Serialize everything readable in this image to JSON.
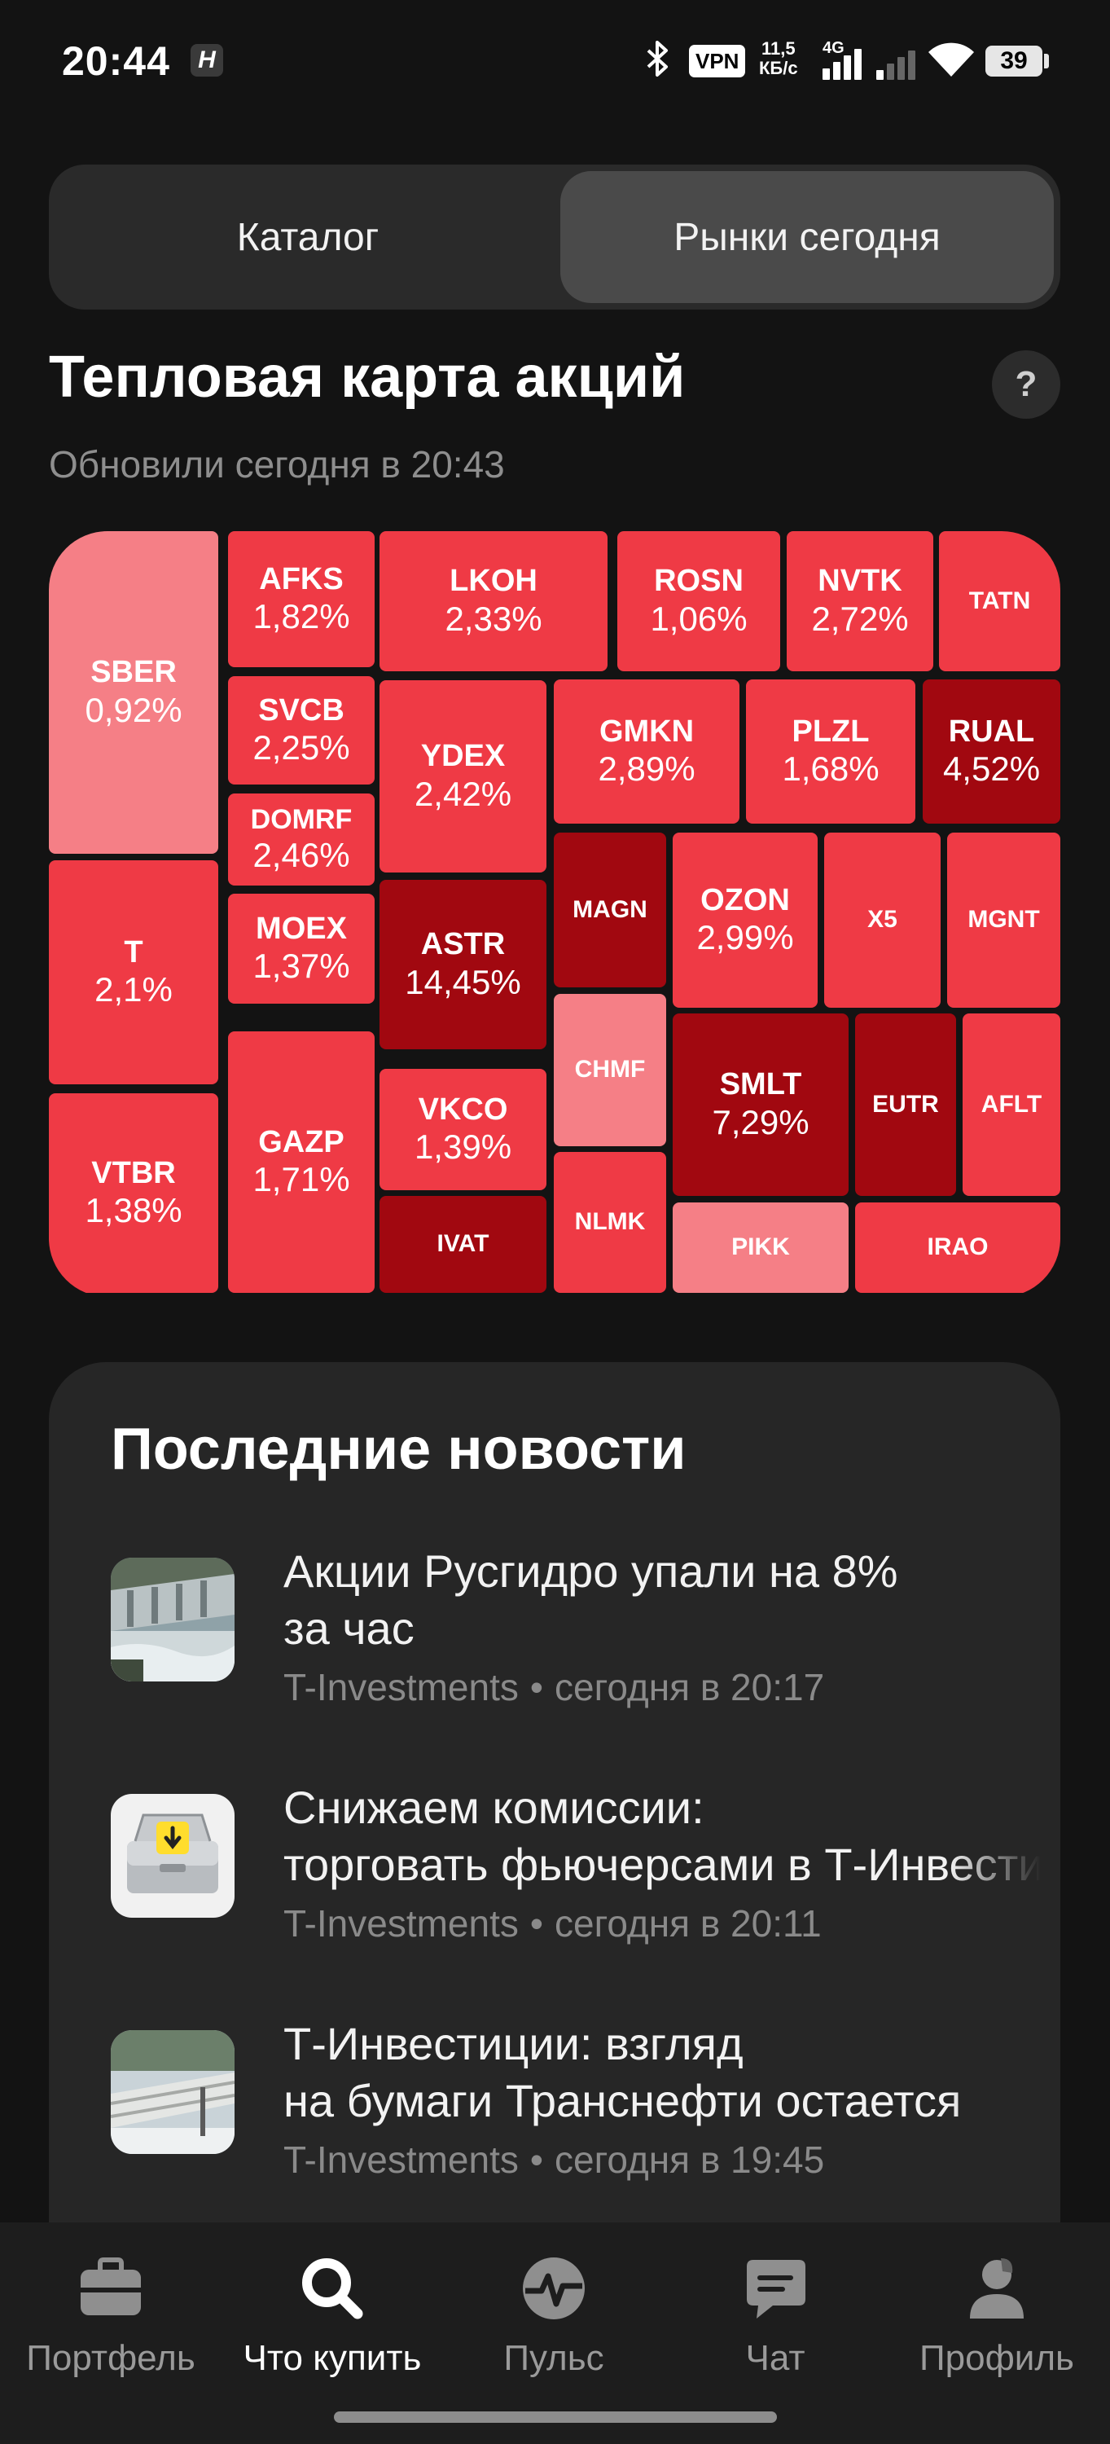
{
  "status_bar": {
    "time": "20:44",
    "app_badge": "H",
    "vpn": "VPN",
    "net_speed_value": "11,5",
    "net_speed_unit": "КБ/с",
    "network": "4G",
    "battery": "39"
  },
  "segment": {
    "tabs": [
      {
        "label": "Каталог",
        "active": false
      },
      {
        "label": "Рынки сегодня",
        "active": true
      }
    ]
  },
  "heatmap": {
    "title": "Тепловая карта акций",
    "help": "?",
    "updated": "Обновили сегодня в 20:43",
    "colors": {
      "light": "#f57f86",
      "mid": "#ef3a45",
      "dark": "#a10810"
    },
    "tiles": [
      {
        "ticker": "SBER",
        "change": "0,92%",
        "tone": "light"
      },
      {
        "ticker": "T",
        "change": "2,1%",
        "tone": "mid"
      },
      {
        "ticker": "VTBR",
        "change": "1,38%",
        "tone": "mid"
      },
      {
        "ticker": "AFKS",
        "change": "1,82%",
        "tone": "mid"
      },
      {
        "ticker": "SVCB",
        "change": "2,25%",
        "tone": "mid"
      },
      {
        "ticker": "DOMRF",
        "change": "2,46%",
        "tone": "mid"
      },
      {
        "ticker": "MOEX",
        "change": "1,37%",
        "tone": "mid"
      },
      {
        "ticker": "GAZP",
        "change": "1,71%",
        "tone": "mid"
      },
      {
        "ticker": "LKOH",
        "change": "2,33%",
        "tone": "mid"
      },
      {
        "ticker": "YDEX",
        "change": "2,42%",
        "tone": "mid"
      },
      {
        "ticker": "ASTR",
        "change": "14,45%",
        "tone": "dark"
      },
      {
        "ticker": "VKCO",
        "change": "1,39%",
        "tone": "mid"
      },
      {
        "ticker": "IVAT",
        "change": "",
        "tone": "dark"
      },
      {
        "ticker": "ROSN",
        "change": "1,06%",
        "tone": "mid"
      },
      {
        "ticker": "NVTK",
        "change": "2,72%",
        "tone": "mid"
      },
      {
        "ticker": "TATN",
        "change": "",
        "tone": "mid"
      },
      {
        "ticker": "GMKN",
        "change": "2,89%",
        "tone": "mid"
      },
      {
        "ticker": "PLZL",
        "change": "1,68%",
        "tone": "mid"
      },
      {
        "ticker": "RUAL",
        "change": "4,52%",
        "tone": "dark"
      },
      {
        "ticker": "MAGN",
        "change": "",
        "tone": "dark"
      },
      {
        "ticker": "OZON",
        "change": "2,99%",
        "tone": "mid"
      },
      {
        "ticker": "X5",
        "change": "",
        "tone": "mid"
      },
      {
        "ticker": "MGNT",
        "change": "",
        "tone": "mid"
      },
      {
        "ticker": "CHMF",
        "change": "",
        "tone": "light"
      },
      {
        "ticker": "SMLT",
        "change": "7,29%",
        "tone": "dark"
      },
      {
        "ticker": "EUTR",
        "change": "",
        "tone": "dark"
      },
      {
        "ticker": "AFLT",
        "change": "",
        "tone": "mid"
      },
      {
        "ticker": "NLMK",
        "change": "",
        "tone": "mid"
      },
      {
        "ticker": "PIKK",
        "change": "",
        "tone": "light"
      },
      {
        "ticker": "IRAO",
        "change": "",
        "tone": "mid"
      }
    ]
  },
  "news": {
    "title": "Последние новости",
    "items": [
      {
        "line1": "Акции Русгидро упали на 8%",
        "line2": "за час",
        "source": "T-Investments",
        "time": "сегодня в 20:17",
        "thumb": "dam-image"
      },
      {
        "line1": "Снижаем комиссии:",
        "line2": "торговать фьючерсами в Т-Инвестициях",
        "source": "T-Investments",
        "time": "сегодня в 20:11",
        "thumb": "briefcase-image"
      },
      {
        "line1": "Т-Инвестиции: взгляд",
        "line2": "на бумаги Транснефти остается",
        "source": "T-Investments",
        "time": "сегодня в 19:45",
        "thumb": "pipeline-image"
      }
    ],
    "separator": "•"
  },
  "bottom_nav": {
    "items": [
      {
        "label": "Портфель",
        "icon": "briefcase-icon",
        "active": false
      },
      {
        "label": "Что купить",
        "icon": "search-icon",
        "active": true
      },
      {
        "label": "Пульс",
        "icon": "pulse-icon",
        "active": false
      },
      {
        "label": "Чат",
        "icon": "chat-icon",
        "active": false
      },
      {
        "label": "Профиль",
        "icon": "profile-icon",
        "active": false
      }
    ]
  }
}
